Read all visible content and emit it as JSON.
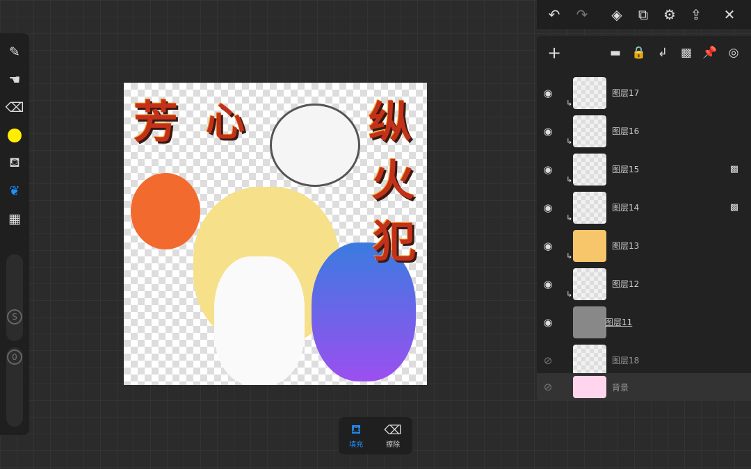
{
  "colors": {
    "accent": "#1e90ff",
    "current_color": "#ffee00",
    "background_layer": "#ffd6ee"
  },
  "toolbar": {
    "tools": [
      {
        "name": "pen",
        "glyph": "✎"
      },
      {
        "name": "smudge",
        "glyph": "☚"
      },
      {
        "name": "eraser",
        "glyph": "⌫"
      },
      {
        "name": "color"
      },
      {
        "name": "fill",
        "glyph": "⛾"
      },
      {
        "name": "lasso",
        "glyph": "❦"
      },
      {
        "name": "layers-grid",
        "glyph": "▦"
      }
    ],
    "size_label": "S",
    "opacity_label": "0"
  },
  "topbar": {
    "undo": "↶",
    "redo": "↷",
    "layers": "◈",
    "files": "⧉",
    "settings": "⚙",
    "share": "⇪",
    "close": "✕"
  },
  "panel": {
    "tools": {
      "add": "+",
      "folder": "▬",
      "lock": "🔒",
      "clip": "↲",
      "alpha": "▩",
      "pin": "📌",
      "target": "◎"
    },
    "layers": [
      {
        "name": "图层17",
        "visible": true,
        "clipped": true,
        "alpha_lock": false
      },
      {
        "name": "图层16",
        "visible": true,
        "clipped": true,
        "alpha_lock": false
      },
      {
        "name": "图层15",
        "visible": true,
        "clipped": true,
        "alpha_lock": true
      },
      {
        "name": "图层14",
        "visible": true,
        "clipped": true,
        "alpha_lock": true
      },
      {
        "name": "图层13",
        "visible": true,
        "clipped": true,
        "alpha_lock": false
      },
      {
        "name": "图层12",
        "visible": true,
        "clipped": true,
        "alpha_lock": false
      },
      {
        "name": "图层11",
        "visible": true,
        "clipped": false,
        "alpha_lock": false,
        "selected": true
      },
      {
        "name": "图层18",
        "visible": false,
        "clipped": false,
        "alpha_lock": false
      },
      {
        "name": "背景",
        "visible": false,
        "clipped": false,
        "alpha_lock": false
      }
    ]
  },
  "artwork": {
    "title_chars": [
      "芳",
      "心",
      "纵",
      "火",
      "犯"
    ]
  },
  "bottom": {
    "fill_label": "填充",
    "erase_label": "擦除"
  }
}
